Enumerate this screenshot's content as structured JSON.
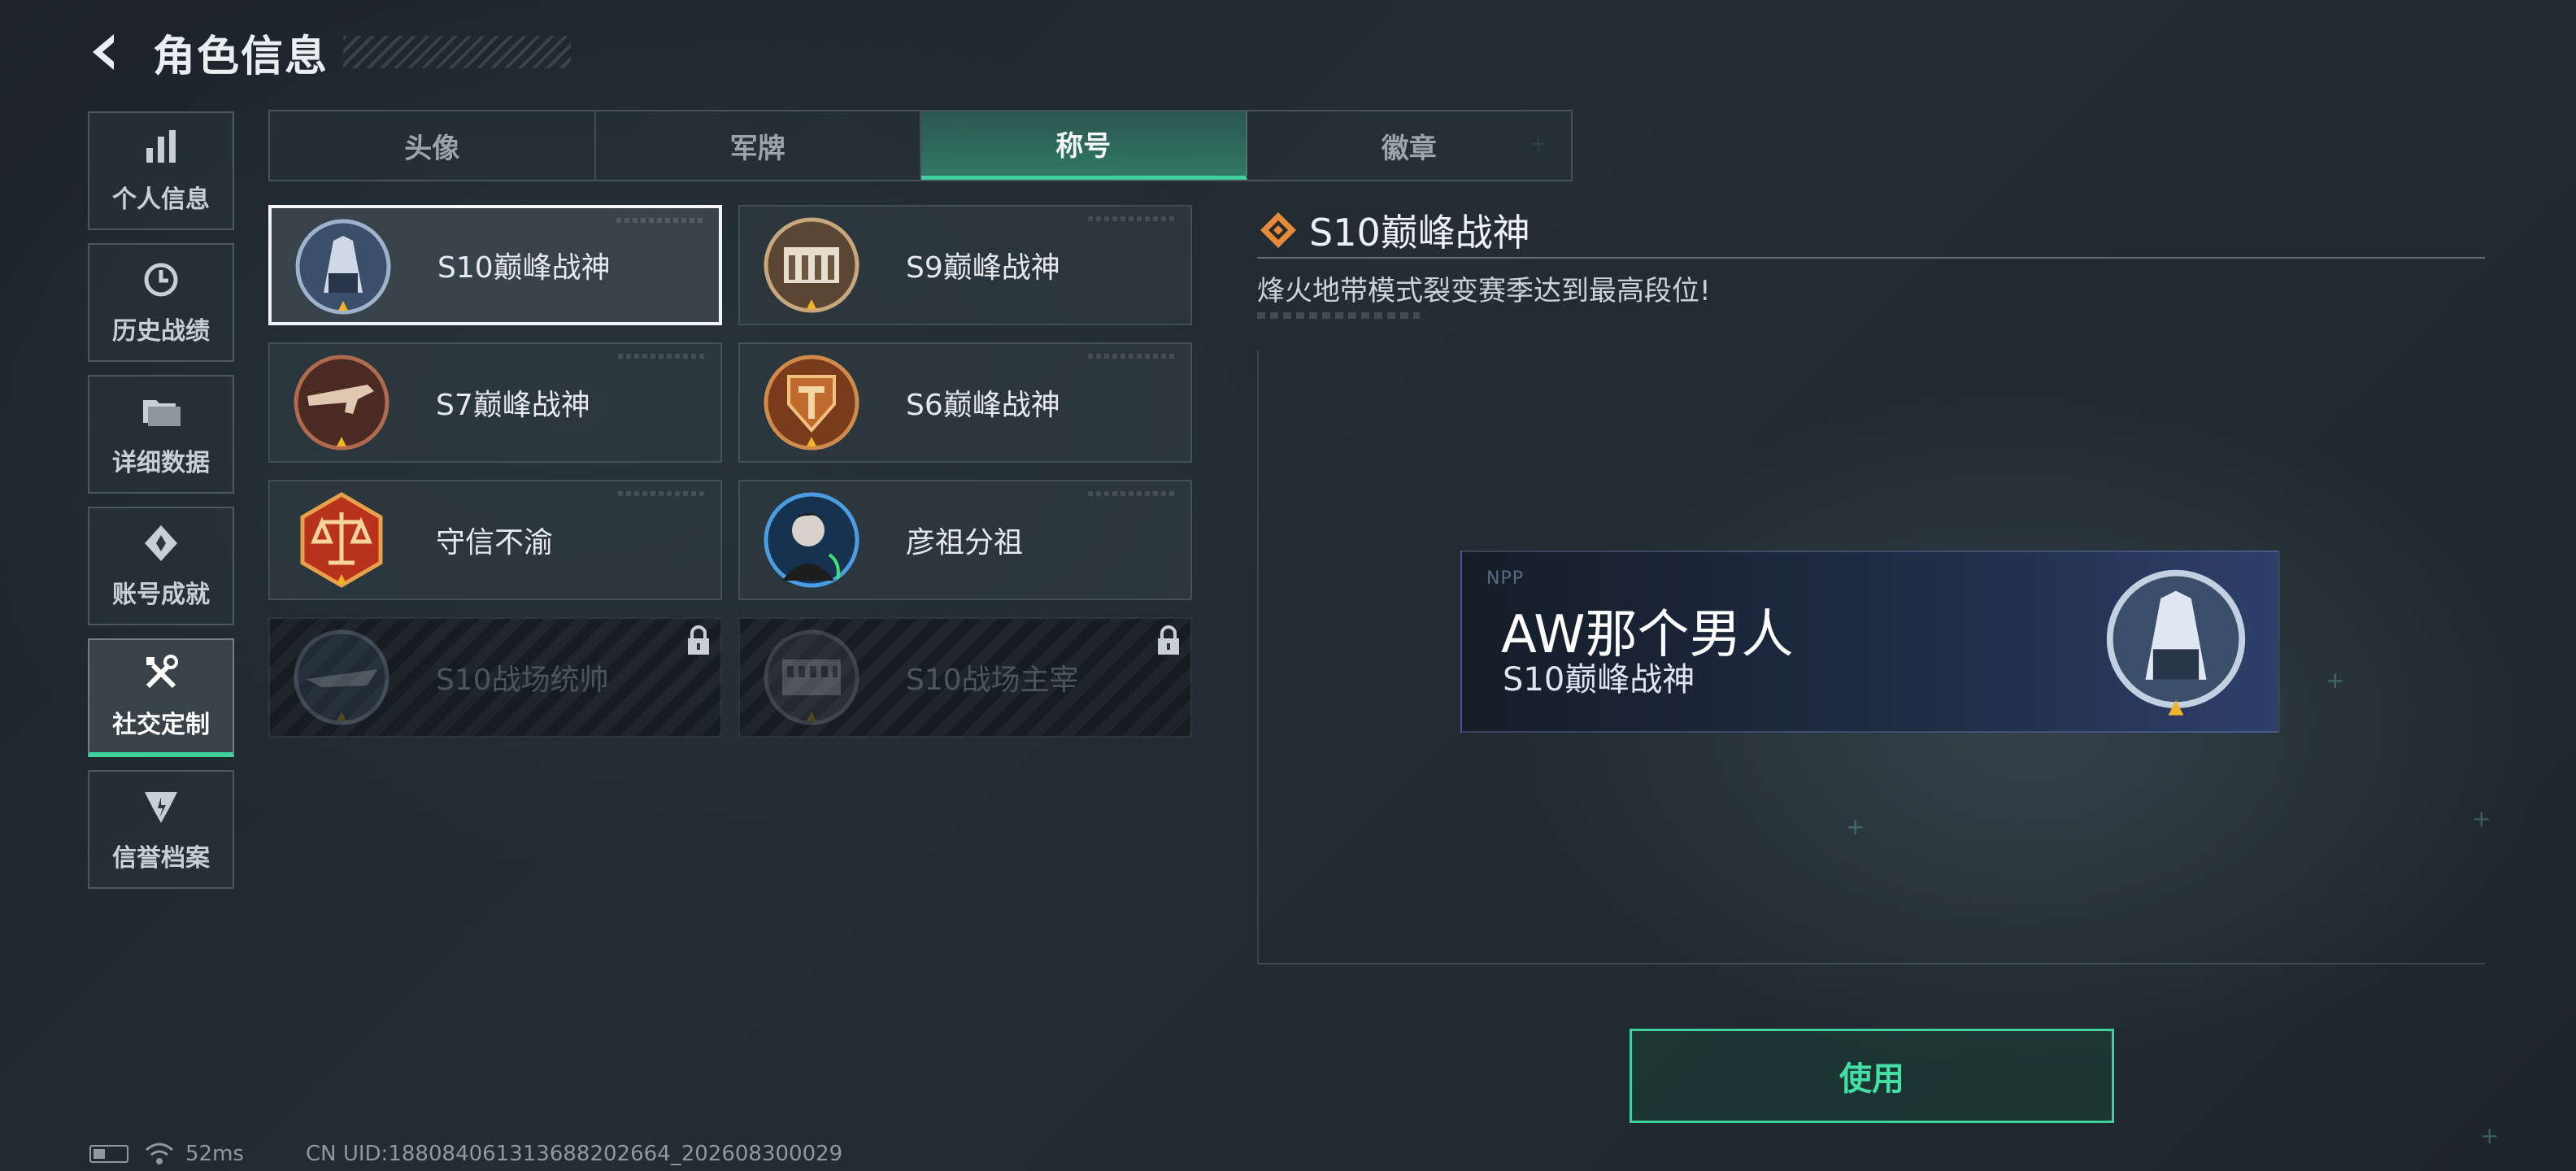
{
  "header": {
    "title": "角色信息"
  },
  "sidebar": {
    "items": [
      {
        "label": "个人信息",
        "icon": "bar-chart-icon",
        "active": false
      },
      {
        "label": "历史战绩",
        "icon": "history-clock-icon",
        "active": false
      },
      {
        "label": "详细数据",
        "icon": "folder-icon",
        "active": false
      },
      {
        "label": "账号成就",
        "icon": "achievement-icon",
        "active": false
      },
      {
        "label": "社交定制",
        "icon": "tools-icon",
        "active": true
      },
      {
        "label": "信誉档案",
        "icon": "credit-shield-icon",
        "active": false
      }
    ]
  },
  "tabs": [
    {
      "label": "头像",
      "active": false
    },
    {
      "label": "军牌",
      "active": false
    },
    {
      "label": "称号",
      "active": true
    },
    {
      "label": "徽章",
      "active": false
    }
  ],
  "titles": [
    {
      "name": "S10巅峰战神",
      "icon": "s10-tower-emblem-icon",
      "selected": true,
      "locked": false
    },
    {
      "name": "S9巅峰战神",
      "icon": "s9-building-emblem-icon",
      "selected": false,
      "locked": false
    },
    {
      "name": "S7巅峰战神",
      "icon": "s7-rifle-emblem-icon",
      "selected": false,
      "locked": false
    },
    {
      "name": "S6巅峰战神",
      "icon": "s6-shield-emblem-icon",
      "selected": false,
      "locked": false
    },
    {
      "name": "守信不渝",
      "icon": "scales-emblem-icon",
      "selected": false,
      "locked": false
    },
    {
      "name": "彦祖分祖",
      "icon": "portrait-emblem-icon",
      "selected": false,
      "locked": false
    },
    {
      "name": "S10战场统帅",
      "icon": "aircraft-emblem-icon",
      "selected": false,
      "locked": true
    },
    {
      "name": "S10战场主宰",
      "icon": "colosseum-emblem-icon",
      "selected": false,
      "locked": true
    }
  ],
  "detail": {
    "title": "S10巅峰战神",
    "description": "烽火地带模式裂变赛季达到最高段位!"
  },
  "preview": {
    "watermark": "NPP",
    "player_name": "AW那个男人",
    "title": "S10巅峰战神"
  },
  "use_button": {
    "label": "使用"
  },
  "status": {
    "ping": "52ms",
    "uid": "CN UID:18808406131368820266​4_202608300029"
  },
  "colors": {
    "accent": "#3fd19b",
    "selected_border": "#f2f4f5",
    "orange": "#e58a3a"
  }
}
